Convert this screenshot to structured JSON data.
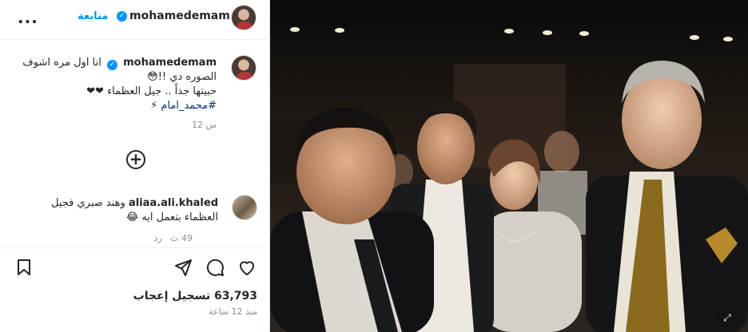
{
  "header": {
    "username": "mohamedemam",
    "follow_label": "متابعة",
    "more_label": "..."
  },
  "caption": {
    "username": "mohamedemam",
    "line1": "انا اول مره اشوف",
    "line2": "الصوره دي !!😳",
    "line3": "حبيتها جداً .. جيل العظماء ❤❤",
    "hashtag": "#محمد_امام ⚡",
    "time": "12 س"
  },
  "comment": {
    "username": "aliaa.ali.khaled",
    "text": "وهند صبري فجيل العظماء بتعمل ايه 😂",
    "time": "49 ث",
    "reply_label": "رد"
  },
  "stats": {
    "likes": "63,793 تسجيل إعجاب",
    "posted_ago": "منذ 12 ساعة"
  },
  "icons": {
    "save": "bookmark-icon",
    "share": "send-icon",
    "comment": "comment-icon",
    "like": "heart-icon",
    "add_comment": "plus-circle-icon"
  },
  "colors": {
    "accent": "#0095f6",
    "text": "#262626",
    "muted": "#8e8e8e"
  }
}
